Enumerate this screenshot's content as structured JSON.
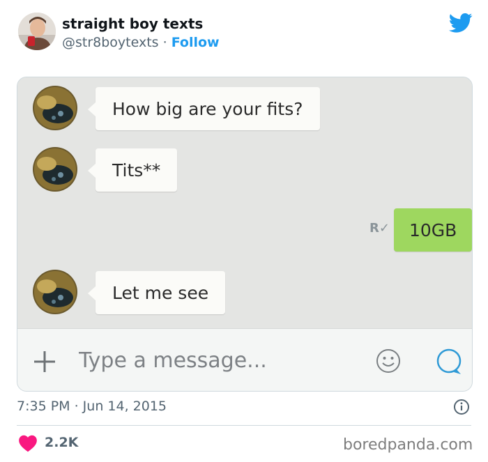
{
  "tweet": {
    "display_name": "straight boy texts",
    "handle": "@str8boytexts",
    "separator": "·",
    "follow_label": "Follow",
    "timestamp": "7:35 PM · Jun 14, 2015",
    "like_count": "2.2K"
  },
  "chat": {
    "messages": [
      {
        "direction": "incoming",
        "text": "How big are your fits?"
      },
      {
        "direction": "incoming",
        "text": "Tits**"
      },
      {
        "direction": "outgoing",
        "text": "10GB",
        "status": "R"
      },
      {
        "direction": "incoming",
        "text": "Let me see"
      }
    ],
    "input_placeholder": "Type a message..."
  },
  "watermark": "boredpanda.com",
  "colors": {
    "twitter_blue": "#1d9bf0",
    "outgoing_bubble": "#9ed75f",
    "incoming_bubble": "#fbfbf8",
    "like_heart": "#f91880",
    "chat_background": "#e4e5e3"
  },
  "icons": [
    "twitter-bird-icon",
    "plus-icon",
    "emoji-icon",
    "send-icon",
    "info-icon",
    "heart-icon"
  ]
}
